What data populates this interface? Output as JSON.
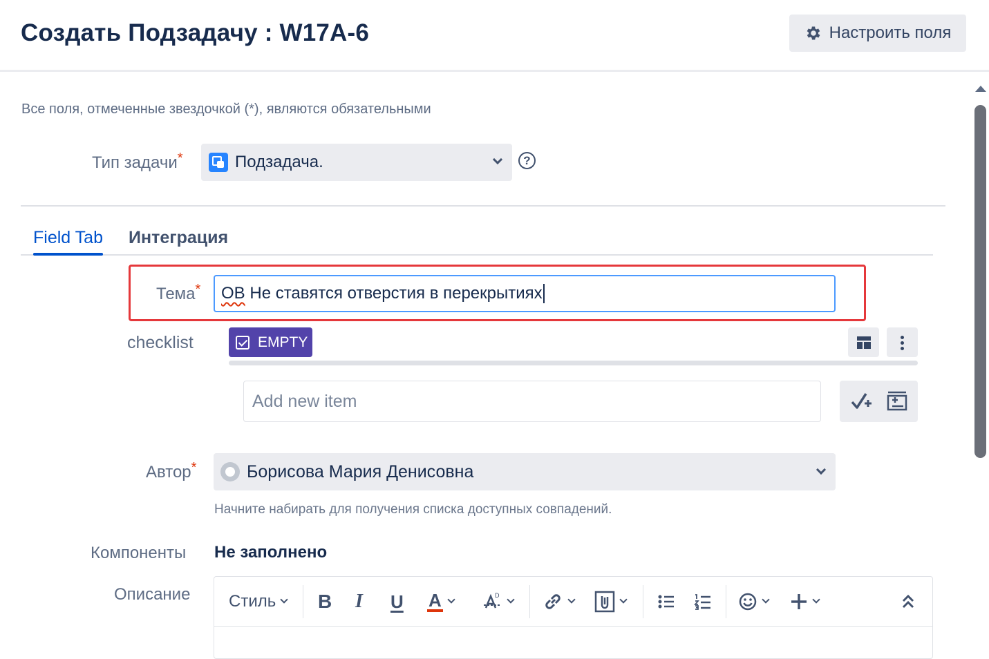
{
  "header": {
    "title": "Создать Подзадачу : W17A-6",
    "configure_fields_label": "Настроить поля",
    "configure_icon": "gear-icon"
  },
  "form": {
    "required_note": "Все поля, отмеченные звездочкой (*), являются обязательными",
    "required_mark": "*",
    "issue_type": {
      "label": "Тип задачи",
      "value": "Подзадача.",
      "icon": "subtask-icon"
    },
    "tabs": [
      {
        "label": "Field Tab",
        "active": true
      },
      {
        "label": "Интеграция",
        "active": false
      }
    ],
    "summary": {
      "label": "Тема",
      "value_prefix": "ОВ",
      "value_rest": " Не ставятся отверстия в перекрытиях"
    },
    "checklist": {
      "label": "checklist",
      "badge": "EMPTY",
      "add_placeholder": "Add new item"
    },
    "author": {
      "label": "Автор",
      "value": "Борисова Мария Денисовна",
      "hint": "Начните набирать для получения списка доступных совпадений."
    },
    "components": {
      "label": "Компоненты",
      "value": "Не заполнено"
    },
    "description": {
      "label": "Описание",
      "style_label": "Стиль",
      "bold": "B",
      "italic": "I",
      "underline": "U",
      "text_color": "A"
    }
  },
  "colors": {
    "accent": "#0052cc",
    "highlight_border": "#e5383b",
    "badge": "#5243aa",
    "required": "#de350b"
  }
}
